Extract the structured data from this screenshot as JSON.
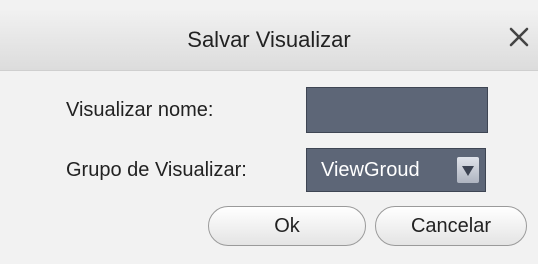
{
  "dialog": {
    "title": "Salvar Visualizar",
    "close_icon": "close-icon"
  },
  "form": {
    "name_label": "Visualizar nome:",
    "name_value": "",
    "group_label": "Grupo de Visualizar:",
    "group_selected": "ViewGroud",
    "dropdown_icon": "triangle-down-icon"
  },
  "buttons": {
    "ok_label": "Ok",
    "cancel_label": "Cancelar"
  },
  "colors": {
    "field_background": "#5d6677",
    "dialog_background": "#f2f2f2"
  }
}
